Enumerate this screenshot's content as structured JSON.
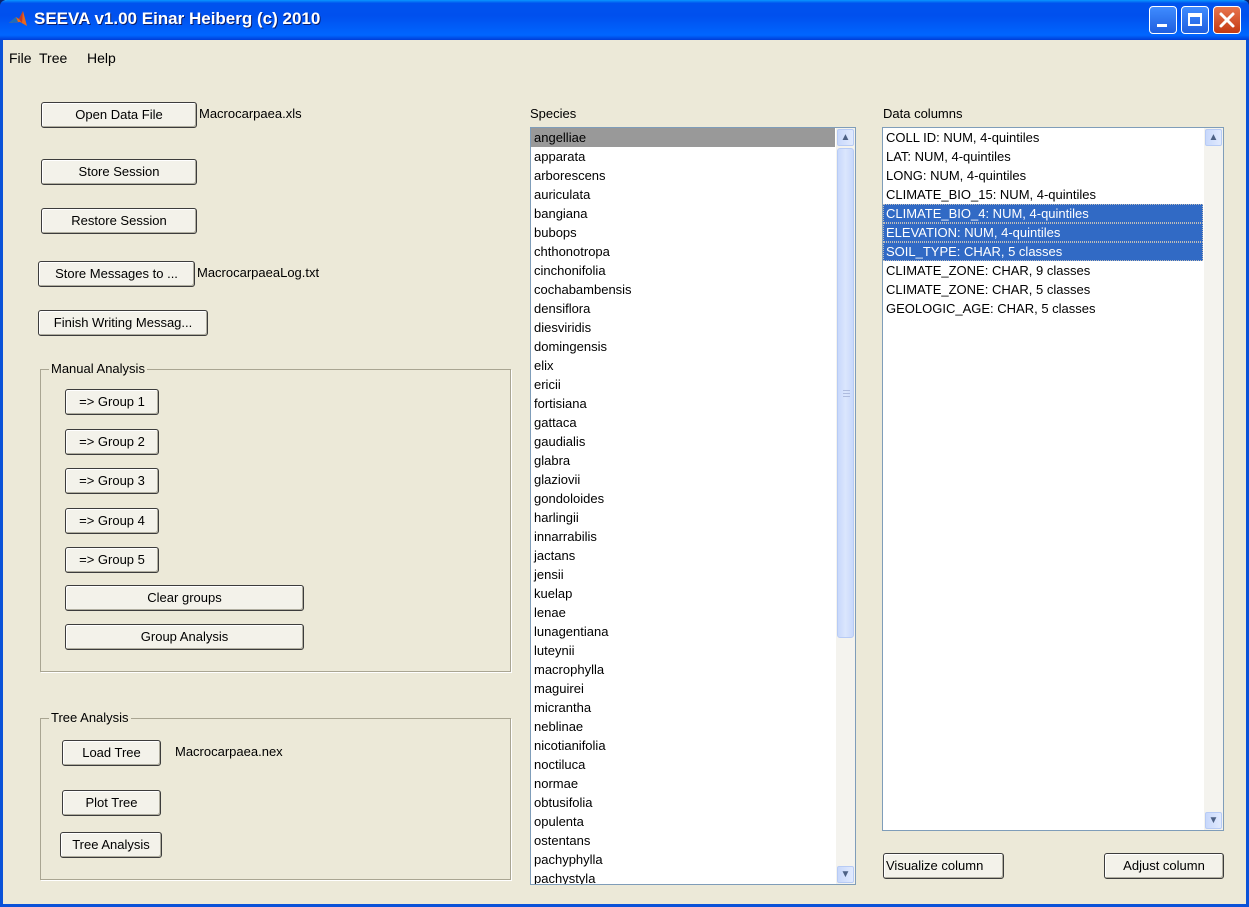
{
  "window": {
    "title": "SEEVA v1.00 Einar Heiberg (c) 2010"
  },
  "menu": [
    "File",
    "Tree",
    "Help"
  ],
  "left": {
    "open_data_file": "Open Data File",
    "data_file_name": "Macrocarpaea.xls",
    "store_session": "Store Session",
    "restore_session": "Restore Session",
    "store_messages": "Store Messages to ...",
    "log_file_name": "MacrocarpaeaLog.txt",
    "finish_writing": "Finish Writing Messag...",
    "manual_analysis": {
      "title": "Manual Analysis",
      "groups": [
        "=> Group 1",
        "=> Group 2",
        "=> Group 3",
        "=> Group 4",
        "=> Group 5"
      ],
      "clear_groups": "Clear groups",
      "group_analysis": "Group Analysis"
    },
    "tree_analysis": {
      "title": "Tree Analysis",
      "load_tree": "Load Tree",
      "tree_file_name": "Macrocarpaea.nex",
      "plot_tree": "Plot Tree",
      "tree_analysis_button": "Tree Analysis"
    }
  },
  "species": {
    "label": "Species",
    "selected": "angelliae",
    "items": [
      "angelliae",
      "apparata",
      "arborescens",
      "auriculata",
      "bangiana",
      "bubops",
      "chthonotropa",
      "cinchonifolia",
      "cochabambensis",
      "densiflora",
      "diesviridis",
      "domingensis",
      "elix",
      "ericii",
      "fortisiana",
      "gattaca",
      "gaudialis",
      "glabra",
      "glaziovii",
      "gondoloides",
      "harlingii",
      "innarrabilis",
      "jactans",
      "jensii",
      "kuelap",
      "lenae",
      "lunagentiana",
      "luteynii",
      "macrophylla",
      "maguirei",
      "micrantha",
      "neblinae",
      "nicotianifolia",
      "noctiluca",
      "normae",
      "obtusifolia",
      "opulenta",
      "ostentans",
      "pachyphylla",
      "pachystyla"
    ]
  },
  "data_columns": {
    "label": "Data columns",
    "items": [
      "COLL ID: NUM, 4-quintiles",
      "LAT: NUM, 4-quintiles",
      "LONG: NUM, 4-quintiles",
      "CLIMATE_BIO_15: NUM, 4-quintiles",
      "CLIMATE_BIO_4: NUM, 4-quintiles",
      "ELEVATION: NUM, 4-quintiles",
      "SOIL_TYPE: CHAR, 5 classes",
      "CLIMATE_ZONE: CHAR, 9 classes",
      "CLIMATE_ZONE: CHAR, 5 classes",
      "GEOLOGIC_AGE: CHAR, 5 classes"
    ],
    "selected": [
      "CLIMATE_BIO_4: NUM, 4-quintiles",
      "ELEVATION: NUM, 4-quintiles",
      "SOIL_TYPE: CHAR, 5 classes"
    ],
    "visualize_column": "Visualize column",
    "adjust_column": "Adjust column"
  },
  "colors": {
    "title_bar": "#0054e3",
    "selection": "#316ac5",
    "species_selection": "#999999",
    "face": "#ece9d8"
  }
}
